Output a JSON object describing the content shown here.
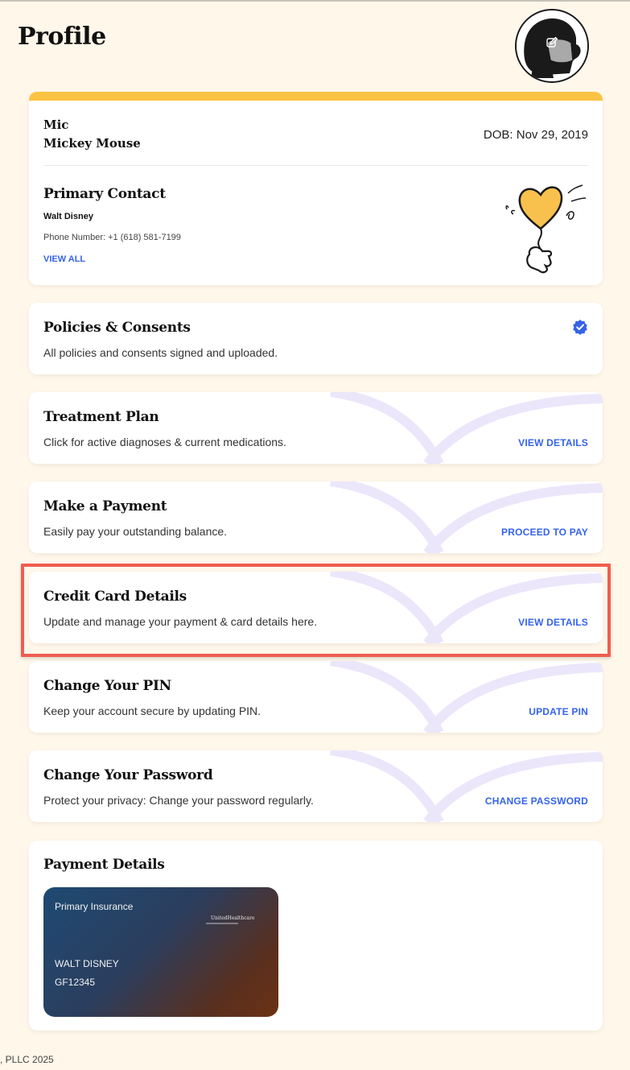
{
  "header": {
    "title": "Profile"
  },
  "patient": {
    "nickname": "Mic",
    "full_name": "Mickey Mouse",
    "dob": "DOB: Nov 29, 2019"
  },
  "primary_contact": {
    "title": "Primary Contact",
    "name": "Walt Disney",
    "phone": "Phone Number: +1 (618) 581-7199",
    "view_all": "VIEW ALL"
  },
  "policies": {
    "title": "Policies & Consents",
    "desc": "All policies and consents signed and uploaded."
  },
  "treatment": {
    "title": "Treatment Plan",
    "desc": "Click for active diagnoses & current medications.",
    "action": "VIEW DETAILS"
  },
  "payment": {
    "title": "Make a Payment",
    "desc": "Easily pay your outstanding balance.",
    "action": "PROCEED TO PAY"
  },
  "credit_card": {
    "title": "Credit Card Details",
    "desc": "Update and manage your payment & card details here.",
    "action": "VIEW DETAILS"
  },
  "pin": {
    "title": "Change Your PIN",
    "desc": "Keep your account secure by updating PIN.",
    "action": "UPDATE PIN"
  },
  "password": {
    "title": "Change Your Password",
    "desc": "Protect your privacy: Change your password regularly.",
    "action": "CHANGE PASSWORD"
  },
  "payment_details": {
    "title": "Payment Details",
    "card": {
      "label": "Primary Insurance",
      "insurer": "UnitedHealthcare",
      "member_name": "WALT DISNEY",
      "member_id": "GF12345"
    }
  },
  "footer": {
    "text": ", PLLC 2025"
  },
  "colors": {
    "background": "#fff7ea",
    "accent_yellow": "#fbc343",
    "link_blue": "#3563e9",
    "highlight_red": "#ef5d4f",
    "deco_lavender": "#ece6fb"
  },
  "icons": {
    "verified": "verified-check-icon",
    "edit": "edit-icon"
  }
}
